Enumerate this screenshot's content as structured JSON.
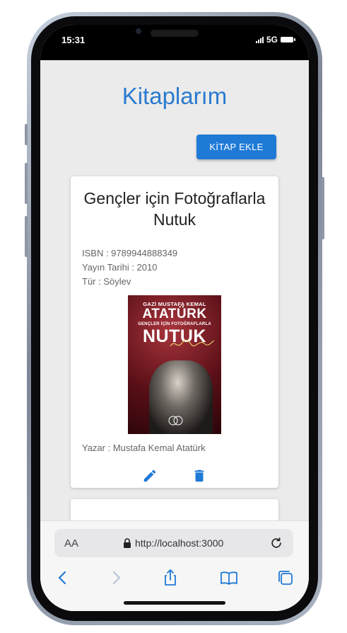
{
  "status_bar": {
    "time": "15:31",
    "network": "5G"
  },
  "page": {
    "title": "Kitaplarım",
    "add_button_label": "KİTAP EKLE"
  },
  "book": {
    "title": "Gençler için Fotoğraflarla Nutuk",
    "isbn_line": "ISBN : 9789944888349",
    "publish_line": "Yayın Tarihi : 2010",
    "genre_line": "Tür : Söylev",
    "author_line": "Yazar : Mustafa Kemal Atatürk",
    "cover": {
      "line1": "GAZİ MUSTAFA KEMAL",
      "line2": "ATATÜRK",
      "line3": "GENÇLER İÇİN FOTOĞRAFLARLA",
      "line4": "NUTUK"
    }
  },
  "browser": {
    "aa_label": "AA",
    "url": "http://localhost:3000"
  },
  "icons": {
    "edit": "edit-icon",
    "delete": "delete-icon",
    "lock": "lock-icon",
    "reload": "reload-icon",
    "back": "back-icon",
    "forward": "forward-icon",
    "share": "share-icon",
    "bookmarks": "bookmarks-icon",
    "tabs": "tabs-icon"
  },
  "colors": {
    "accent": "#2a7bd0",
    "button": "#1f7ad6",
    "screen_bg": "#ebebeb"
  }
}
